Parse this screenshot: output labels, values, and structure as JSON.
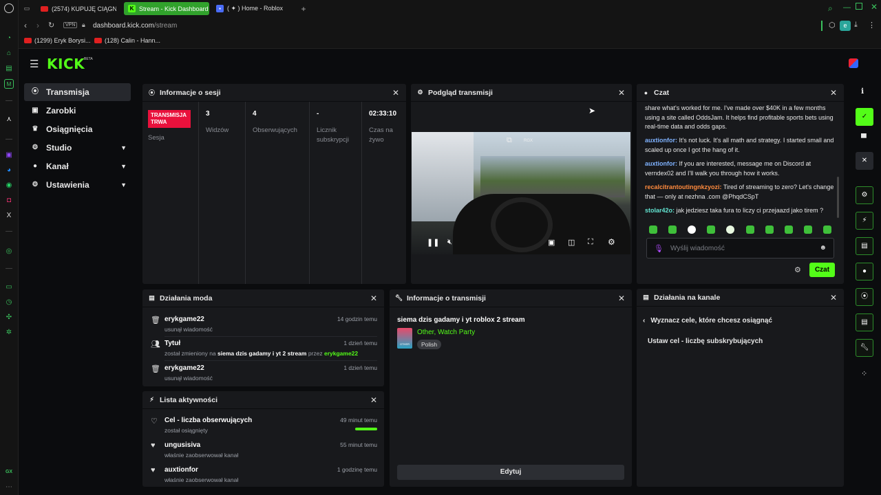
{
  "browser": {
    "tabs": [
      {
        "label": "(2574) KUPUJĘ CIĄGNIK"
      },
      {
        "label": "Stream - Kick Dashboard"
      },
      {
        "label": "( ✦ ) Home - Roblox"
      }
    ],
    "new_tab": "+",
    "vpn": "VPN",
    "url_host": "dashboard.kick.com",
    "url_path": "/stream",
    "profile_letter": "e",
    "bookmarks": [
      {
        "label": "(1299) Eryk Borysi..."
      },
      {
        "label": "(128) Calin - Hann..."
      }
    ],
    "sidebar_bottom": "GX"
  },
  "header": {
    "logo": "KICK",
    "logo_badge": "BETA"
  },
  "nav": [
    {
      "label": "Transmisja",
      "icon": "broadcast-icon"
    },
    {
      "label": "Zarobki",
      "icon": "wallet-icon"
    },
    {
      "label": "Osiągnięcia",
      "icon": "trophy-icon"
    },
    {
      "label": "Studio",
      "icon": "gear-icon"
    },
    {
      "label": "Kanał",
      "icon": "user-icon"
    },
    {
      "label": "Ustawienia",
      "icon": "gear-icon"
    }
  ],
  "session": {
    "title": "Informacje o sesji",
    "badge": "TRANSMISJA TRWA",
    "badge_label": "Sesja",
    "stats": [
      {
        "value": "3",
        "label": "Widzów"
      },
      {
        "value": "4",
        "label": "Obserwujących"
      },
      {
        "value": "-",
        "label": "Licznik subskrypcji"
      },
      {
        "value": "02:33:10",
        "label": "Czas na żywo"
      }
    ]
  },
  "preview": {
    "title": "Podgląd transmisji",
    "rgx": "RGX"
  },
  "chat": {
    "title": "Czat",
    "messages": [
      {
        "user": "",
        "text": "share what's worked for me. I've made over $40K in a few months using a site called OddsJam. It helps find profitable sports bets using real-time data and odds gaps.",
        "color": "#e8e8e8"
      },
      {
        "user": "auxtionfor:",
        "text": " It's not luck. It's all math and strategy. I started small and scaled up once I got the hang of it.",
        "color": "#7fb2ff"
      },
      {
        "user": "auxtionfor:",
        "text": " If you are interested, message me on Discord at verndex02 and I'll walk you through how it works.",
        "color": "#7fb2ff"
      },
      {
        "user": "recalcitrantoutingnkzyozi:",
        "text": " Tired of streaming to zero? Let's change that — only at nezhna .com @PhqdCSpT",
        "color": "#ff8a3d"
      },
      {
        "user": "stolar42o:",
        "text": " jak jedziesz taka fura to liczy ci przejaazd jako tirem ?",
        "color": "#63e6d3"
      }
    ],
    "placeholder": "Wyślij wiadomość",
    "send": "Czat"
  },
  "mod": {
    "title": "Działania moda",
    "rows": [
      {
        "title": "erykgame22",
        "sub": "usunął wiadomość",
        "time": "14 godzin temu"
      },
      {
        "title": "Tytuł",
        "sub_pre": "został zmieniony na ",
        "sub_bold": "siema dzis gadamy i yt 2 stream",
        "sub_mid": " przez ",
        "sub_user": "erykgame22",
        "time": "1 dzień temu"
      },
      {
        "title": "erykgame22",
        "sub": "usunął wiadomość",
        "time": "1 dzień temu"
      }
    ]
  },
  "activity": {
    "title": "Lista aktywności",
    "rows": [
      {
        "title": "Cel - liczba obserwujących",
        "sub": "został osiągnięty",
        "time": "49 minut temu",
        "progress": 1.0
      },
      {
        "title": "ungusisiva",
        "sub": "właśnie zaobserwował kanał",
        "time": "55 minut temu"
      },
      {
        "title": "auxtionfor",
        "sub": "właśnie zaobserwował kanał",
        "time": "1 godzinę temu"
      }
    ]
  },
  "stream_info": {
    "title": "Informacje o transmisji",
    "stream_title": "siema dzis gadamy i yt roblox 2 stream",
    "category": "Other, Watch Party",
    "thumb_label": "OTHER",
    "tag": "Polish",
    "edit": "Edytuj"
  },
  "channel": {
    "title": "Działania na kanale",
    "back_title": "Wyznacz cele, które chcesz osiągnąć",
    "item": "Ustaw cel - liczbę subskrybujących"
  },
  "colors": {
    "accent": "#53fc18",
    "live": "#e9113c"
  }
}
